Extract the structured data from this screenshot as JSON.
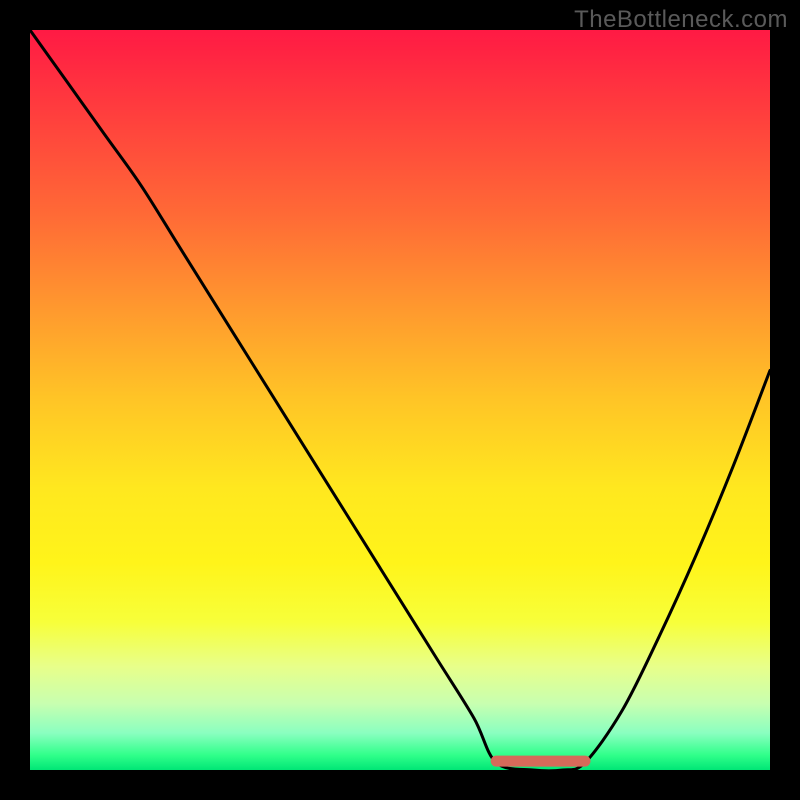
{
  "watermark": "TheBottleneck.com",
  "chart_data": {
    "type": "line",
    "title": "",
    "xlabel": "",
    "ylabel": "",
    "xlim": [
      0,
      100
    ],
    "ylim": [
      0,
      100
    ],
    "grid": false,
    "curve": {
      "name": "bottleneck",
      "note": "V-shaped curve: steep descent from upper-left, flat trough near x≈63–75 at y≈0, then rises toward right. Y interpreted as bottleneck severity (100=red, 0=green).",
      "x": [
        0,
        5,
        10,
        15,
        20,
        25,
        30,
        35,
        40,
        45,
        50,
        55,
        60,
        63,
        68,
        72,
        75,
        80,
        85,
        90,
        95,
        100
      ],
      "y": [
        100,
        93,
        86,
        79,
        71,
        63,
        55,
        47,
        39,
        31,
        23,
        15,
        7,
        1,
        0,
        0,
        1,
        8,
        18,
        29,
        41,
        54
      ]
    },
    "trough_marker": {
      "x_start": 63,
      "x_end": 75,
      "y": 1.2,
      "color": "#d66a5a"
    },
    "gradient_stops": [
      {
        "pos": 0.0,
        "color": "#ff1a44"
      },
      {
        "pos": 0.25,
        "color": "#ff6a36"
      },
      {
        "pos": 0.5,
        "color": "#ffc526"
      },
      {
        "pos": 0.72,
        "color": "#fff41a"
      },
      {
        "pos": 0.91,
        "color": "#c8ffb0"
      },
      {
        "pos": 1.0,
        "color": "#00e676"
      }
    ]
  }
}
